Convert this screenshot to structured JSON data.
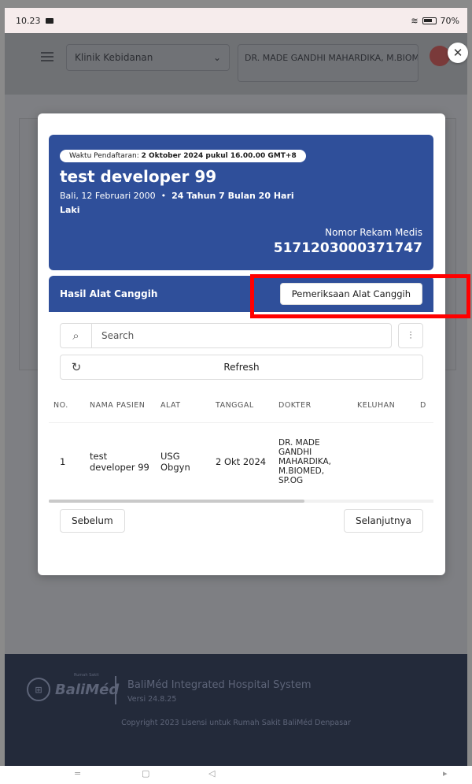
{
  "status": {
    "time": "10.23",
    "battery": "70%"
  },
  "topbar": {
    "clinic": "Klinik Kebidanan",
    "doctor": "DR. MADE GANDHI MAHARDIKA, M.BIOMED"
  },
  "patient": {
    "reg_label": "Waktu Pendaftaran:",
    "reg_value": "2 Oktober 2024 pukul 16.00.00 GMT+8",
    "name": "test developer 99",
    "dob": "Bali, 12 Februari 2000",
    "age": "24 Tahun 7 Bulan 20 Hari",
    "gender": "Laki",
    "rm_label": "Nomor Rekam Medis",
    "rm_number": "5171203000371747"
  },
  "results": {
    "title": "Hasil Alat Canggih",
    "exam_button": "Pemeriksaan Alat Canggih",
    "search_placeholder": "Search",
    "refresh_label": "Refresh",
    "columns": [
      "NO.",
      "NAMA PASIEN",
      "ALAT",
      "TANGGAL",
      "DOKTER",
      "KELUHAN",
      "D"
    ],
    "rows": [
      {
        "no": "1",
        "nama": "test developer 99",
        "alat": "USG Obgyn",
        "tanggal": "2 Okt 2024",
        "dokter": "DR. MADE GANDHI MAHARDIKA, M.BIOMED, SP.OG",
        "keluhan": ""
      }
    ],
    "prev_label": "Sebelum",
    "next_label": "Selanjutnya"
  },
  "footer": {
    "logo_text": "BaliMéd",
    "logo_tag": "Rumah Sakit",
    "title": "BaliMéd Integrated Hospital System",
    "version": "Versi 24.8.25",
    "copyright": "Copyright 2023 Lisensi untuk Rumah Sakit BaliMéd Denpasar"
  },
  "nav": {
    "menu": "=",
    "home": "▢",
    "back": "◁",
    "extra": "▸"
  },
  "colors": {
    "primary": "#2f4f9a",
    "highlight": "#ff0000",
    "footer": "#232a3a"
  }
}
